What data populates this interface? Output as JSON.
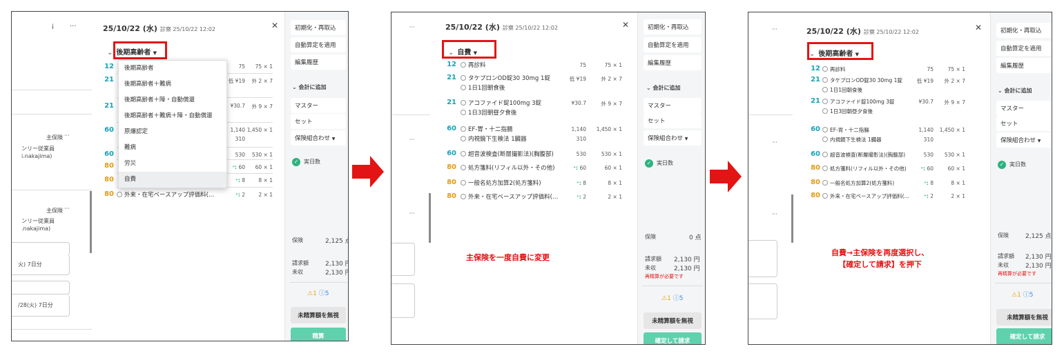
{
  "screen1": {
    "left_icons": {
      "info_icon": "i",
      "more": "···"
    },
    "left_panel": {
      "entry1_label": "主保険",
      "entry1_more": "···",
      "entry1_line2": "ンリー従業員",
      "entry1_line3": "i.nakajima)",
      "entry2_label": "主保険",
      "entry2_more": "···",
      "entry2_line2": "ンリー従業員",
      "entry2_line3": ".nakajima)",
      "item1": "火) 7日分",
      "item2": "/28(火) 7日分"
    },
    "header": {
      "date": "25/10/22 (水)",
      "visit": "診察 25/10/22 12:02",
      "close": "✕"
    },
    "insurance_selected": "後期高齢者",
    "dropdown_options": [
      "後期高齢者",
      "後期高齢者＋難病",
      "後期高齢者＋障・自動償還",
      "後期高齢者＋難病＋障・自動償還",
      "原爆認定",
      "難病",
      "労災",
      "自費"
    ],
    "rows": [
      {
        "num": "12",
        "c1": "75",
        "q": "75 × 1"
      },
      {
        "num": "21",
        "c1": "低 ¥19",
        "q": "外 2 × 7"
      },
      {
        "num": "21",
        "c1": "¥30.7",
        "q": "外 9 × 7"
      },
      {
        "num": "60",
        "c1": "1,140",
        "c2": "310",
        "q": "1,450 × 1"
      },
      {
        "num": "60",
        "c1": "530",
        "q": "530 × 1"
      },
      {
        "num": "80",
        "c1": "60",
        "q": "60 × 1"
      },
      {
        "num": "80",
        "c1": "8",
        "q": "8 × 1"
      },
      {
        "num": "80",
        "name": "外来・在宅ベースアップ評価料(…",
        "c1": "2",
        "q": "2 × 1"
      }
    ],
    "right": {
      "btn_init": "初期化・再取込",
      "btn_auto": "自動算定を適用",
      "btn_history": "編集履歴",
      "add_to_bill": "会計に追加",
      "btn_master": "マスター",
      "btn_set": "セット",
      "btn_combo": "保険組合わせ",
      "actual_days": "実日数",
      "insurance_label": "保険",
      "insurance_points": "2,125 点",
      "billed_label": "請求額",
      "billed_value": "2,130 円",
      "unpaid_label": "未収",
      "unpaid_value": "2,130 円",
      "warn_count": "1",
      "info_count": "5",
      "btn_ignore": "未精算額を無視",
      "btn_settle": "精算"
    }
  },
  "screen2": {
    "left_more": [
      "···",
      "···",
      "···"
    ],
    "header": {
      "date": "25/10/22 (水)",
      "visit": "診察 25/10/22 12:02",
      "close": "✕"
    },
    "insurance_selected": "自費",
    "rows": [
      {
        "num": "12",
        "name": "再診料",
        "c1": "75",
        "q": "75 × 1"
      },
      {
        "num": "21",
        "name": "タケプロンOD錠30 30mg 1錠",
        "c1": "低 ¥19",
        "q": "外 2 × 7",
        "sub": "1日1回朝食後"
      },
      {
        "num": "21",
        "name": "アコファイド錠100mg 3錠",
        "c1": "¥30.7",
        "q": "外 9 × 7",
        "sub": "1日3回朝昼夕食後"
      },
      {
        "num": "60",
        "name": "EF-胃・十二指腸",
        "c1": "1,140",
        "q": "1,450 × 1",
        "sub": "内視鏡下生検法 1臓器",
        "c2": "310"
      },
      {
        "num": "60",
        "name": "超音波検査(断層撮影法)(胸腹部)",
        "c1": "530",
        "q": "530 × 1"
      },
      {
        "num": "80",
        "name": "処方箋料(リフィル以外・その他)",
        "c1": "60",
        "q": "60 × 1"
      },
      {
        "num": "80",
        "name": "一般名処方加算2(処方箋料)",
        "c1": "8",
        "q": "8 × 1"
      },
      {
        "num": "80",
        "name": "外来・在宅ベースアップ評価料(…",
        "c1": "2",
        "q": "2 × 1"
      }
    ],
    "annotation": "主保険を一度自費に変更",
    "right": {
      "btn_init": "初期化・再取込",
      "btn_auto": "自動算定を適用",
      "btn_history": "編集履歴",
      "add_to_bill": "会計に追加",
      "btn_master": "マスター",
      "btn_set": "セット",
      "btn_combo": "保険組合わせ",
      "actual_days": "実日数",
      "insurance_label": "保険",
      "insurance_points": "0 点",
      "billed_label": "請求額",
      "billed_value": "2,130 円",
      "unpaid_label": "未収",
      "unpaid_value": "2,130 円",
      "recalc": "再精算が必要です",
      "warn_count": "1",
      "info_count": "5",
      "btn_ignore": "未精算額を無視",
      "btn_confirm": "確定して請求"
    }
  },
  "screen3": {
    "left_more": [
      "···",
      "···",
      "···"
    ],
    "header": {
      "date": "25/10/22 (水)",
      "visit": "診察 25/10/22 12:02",
      "close": "✕"
    },
    "insurance_selected": "後期高齢者",
    "rows": [
      {
        "num": "12",
        "name": "再診料",
        "c1": "75",
        "q": "75 × 1"
      },
      {
        "num": "21",
        "name": "タケプロンOD錠30 30mg 1錠",
        "c1": "低 ¥19",
        "q": "外 2 × 7",
        "sub": "1日1回朝食後"
      },
      {
        "num": "21",
        "name": "アコファイド錠100mg 3錠",
        "c1": "¥30.7",
        "q": "外 9 × 7",
        "sub": "1日3回朝昼夕食後"
      },
      {
        "num": "60",
        "name": "EF-胃・十二指腸",
        "c1": "1,140",
        "q": "1,450 × 1",
        "sub": "内視鏡下生検法 1臓器",
        "c2": "310"
      },
      {
        "num": "60",
        "name": "超音波検査(断層撮影法)(胸腹部)",
        "c1": "530",
        "q": "530 × 1"
      },
      {
        "num": "80",
        "name": "処方箋料(リフィル以外・その他)",
        "c1": "60",
        "q": "60 × 1"
      },
      {
        "num": "80",
        "name": "一般名処方加算2(処方箋料)",
        "c1": "8",
        "q": "8 × 1"
      },
      {
        "num": "80",
        "name": "外来・在宅ベースアップ評価料(…",
        "c1": "2",
        "q": "2 × 1"
      }
    ],
    "annotation_line1": "自費→主保険を再度選択し、",
    "annotation_line2": "【確定して請求】を押下",
    "right": {
      "btn_init": "初期化・再取込",
      "btn_auto": "自動算定を適用",
      "btn_history": "編集履歴",
      "add_to_bill": "会計に追加",
      "btn_master": "マスター",
      "btn_set": "セット",
      "btn_combo": "保険組合わせ",
      "actual_days": "実日数",
      "insurance_label": "保険",
      "insurance_points": "2,125 点",
      "billed_label": "請求額",
      "billed_value": "2,130 円",
      "unpaid_label": "未収",
      "unpaid_value": "2,130 円",
      "recalc": "再精算が必要です",
      "warn_count": "1",
      "info_count": "5",
      "btn_ignore": "未精算額を無視",
      "btn_confirm": "確定して請求"
    }
  },
  "colors": {
    "highlight": "#e31414",
    "teal_button": "#5fd1ad",
    "code_blue": "#17a2b8",
    "code_orange": "#e19b14",
    "check_green": "#2db37f"
  }
}
